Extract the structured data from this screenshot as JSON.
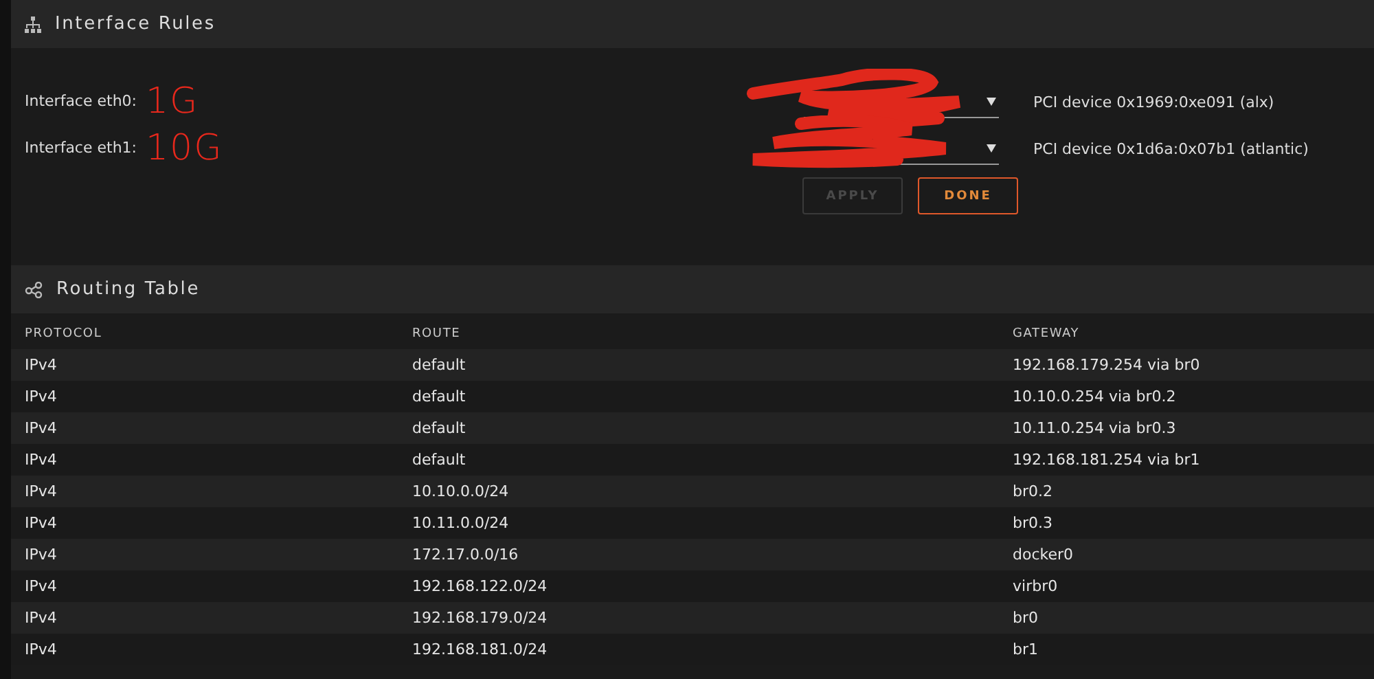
{
  "interface_rules": {
    "title": "Interface Rules",
    "interfaces": [
      {
        "label": "Interface eth0:",
        "annotation": "1G",
        "device": "PCI device 0x1969:0xe091 (alx)",
        "redacted": true
      },
      {
        "label": "Interface eth1:",
        "annotation": "10G",
        "device": "PCI device 0x1d6a:0x07b1 (atlantic)",
        "redacted": true
      }
    ],
    "buttons": [
      {
        "label": "APPLY",
        "disabled": true
      },
      {
        "label": "DONE",
        "disabled": false
      }
    ]
  },
  "routing_table": {
    "title": "Routing Table",
    "columns": [
      "PROTOCOL",
      "ROUTE",
      "GATEWAY"
    ],
    "rows": [
      [
        "IPv4",
        "default",
        "192.168.179.254 via br0"
      ],
      [
        "IPv4",
        "default",
        "10.10.0.254 via br0.2"
      ],
      [
        "IPv4",
        "default",
        "10.11.0.254 via br0.3"
      ],
      [
        "IPv4",
        "default",
        "192.168.181.254 via br1"
      ],
      [
        "IPv4",
        "10.10.0.0/24",
        "br0.2"
      ],
      [
        "IPv4",
        "10.11.0.0/24",
        "br0.3"
      ],
      [
        "IPv4",
        "172.17.0.0/16",
        "docker0"
      ],
      [
        "IPv4",
        "192.168.122.0/24",
        "virbr0"
      ],
      [
        "IPv4",
        "192.168.179.0/24",
        "br0"
      ],
      [
        "IPv4",
        "192.168.181.0/24",
        "br1"
      ]
    ]
  }
}
